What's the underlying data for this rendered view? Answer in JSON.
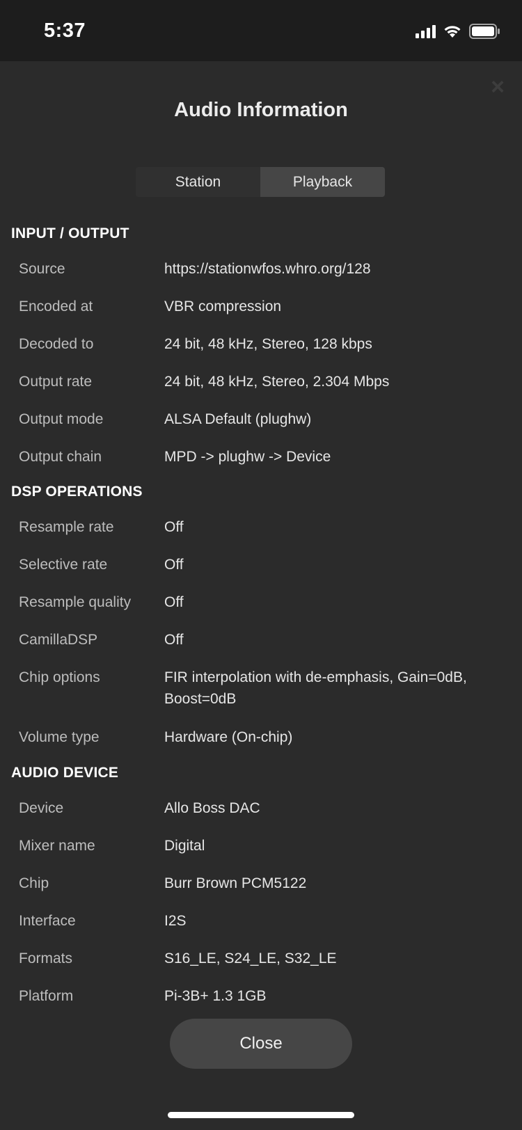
{
  "status_bar": {
    "time": "5:37"
  },
  "dialog": {
    "title": "Audio Information",
    "close_glyph": "×",
    "tabs": [
      {
        "label": "Station",
        "active": false
      },
      {
        "label": "Playback",
        "active": true
      }
    ],
    "close_button_label": "Close"
  },
  "sections": {
    "io": {
      "title": "INPUT / OUTPUT",
      "rows": [
        {
          "label": "Source",
          "value": "https://stationwfos.whro.org/128"
        },
        {
          "label": "Encoded at",
          "value": "VBR compression"
        },
        {
          "label": "Decoded to",
          "value": "24 bit, 48 kHz, Stereo, 128 kbps"
        },
        {
          "label": "Output rate",
          "value": "24 bit, 48 kHz, Stereo, 2.304 Mbps"
        },
        {
          "label": "Output mode",
          "value": "ALSA Default (plughw)"
        },
        {
          "label": "Output chain",
          "value": "MPD -> plughw -> Device"
        }
      ]
    },
    "dsp": {
      "title": "DSP OPERATIONS",
      "rows": [
        {
          "label": "Resample rate",
          "value": "Off"
        },
        {
          "label": "Selective rate",
          "value": "Off"
        },
        {
          "label": "Resample quality",
          "value": "Off"
        },
        {
          "label": "CamillaDSP",
          "value": "Off"
        },
        {
          "label": "Chip options",
          "value": "FIR interpolation with de-emphasis, Gain=0dB, Boost=0dB"
        },
        {
          "label": "Volume type",
          "value": "Hardware (On-chip)"
        }
      ]
    },
    "device": {
      "title": "AUDIO DEVICE",
      "rows": [
        {
          "label": "Device",
          "value": "Allo Boss DAC"
        },
        {
          "label": "Mixer name",
          "value": "Digital"
        },
        {
          "label": "Chip",
          "value": "Burr Brown PCM5122"
        },
        {
          "label": "Interface",
          "value": "I2S"
        },
        {
          "label": "Formats",
          "value": "S16_LE, S24_LE, S32_LE"
        },
        {
          "label": "Platform",
          "value": "Pi-3B+ 1.3 1GB"
        }
      ]
    }
  },
  "icons": {
    "signal": "cellular-signal-icon",
    "wifi": "wifi-icon",
    "battery": "battery-icon",
    "close": "close-icon"
  }
}
